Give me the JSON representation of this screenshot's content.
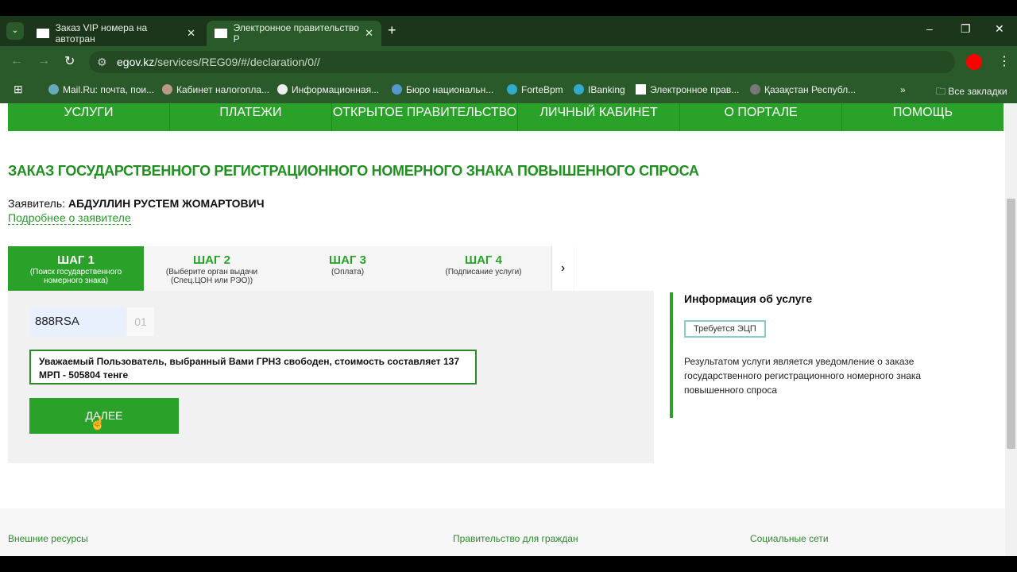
{
  "browser": {
    "tabs": [
      {
        "title": "Заказ VIP номера на автотран",
        "active": false
      },
      {
        "title": "Электронное правительство Р",
        "active": true
      }
    ],
    "url_domain": "egov.kz",
    "url_path": "/services/REG09/#/declaration/0//",
    "bookmarks": [
      "Mail.Ru: почта, пои...",
      "Кабинет налогопла...",
      "Информационная...",
      "Бюро национальн...",
      "ForteBpm",
      "IBanking",
      "Электронное прав...",
      "Қазақстан Республ..."
    ],
    "all_bookmarks": "Все закладки"
  },
  "nav": [
    "УСЛУГИ",
    "ПЛАТЕЖИ",
    "ОТКРЫТОЕ ПРАВИТЕЛЬСТВО",
    "ЛИЧНЫЙ КАБИНЕТ",
    "О ПОРТАЛЕ",
    "ПОМОЩЬ"
  ],
  "title": "ЗАКАЗ ГОСУДАРСТВЕННОГО РЕГИСТРАЦИОННОГО НОМЕРНОГО ЗНАКА ПОВЫШЕННОГО СПРОСА",
  "applicant_label": "Заявитель: ",
  "applicant_name": "АБДУЛЛИН РУСТЕМ ЖОМАРТОВИЧ",
  "applicant_link": "Подробнее о заявителе",
  "steps": [
    {
      "title": "ШАГ 1",
      "desc": "(Поиск государственного номерного знака)"
    },
    {
      "title": "ШАГ 2",
      "desc": "(Выберите орган выдачи (Спец.ЦОН или РЭО))"
    },
    {
      "title": "ШАГ 3",
      "desc": "(Оплата)"
    },
    {
      "title": "ШАГ 4",
      "desc": "(Подписание услуги)"
    }
  ],
  "plate_value": "888RSA",
  "region": "01",
  "message": "Уважаемый Пользователь, выбранный Вами ГРНЗ свободен, стоимость составляет 137 МРП - 505804 тенге",
  "next_button": "ДАЛЕЕ",
  "info": {
    "title": "Информация об услуге",
    "badge": "Требуется ЭЦП",
    "text": "Результатом услуги является уведомление о заказе государственного регистрационного номерного знака повышенного спроса"
  },
  "footer": [
    "Внешние ресурсы",
    "Правительство для граждан",
    "Социальные сети"
  ],
  "colors": {
    "brand": "#2aa22a",
    "chrome": "#2a5a2a"
  }
}
